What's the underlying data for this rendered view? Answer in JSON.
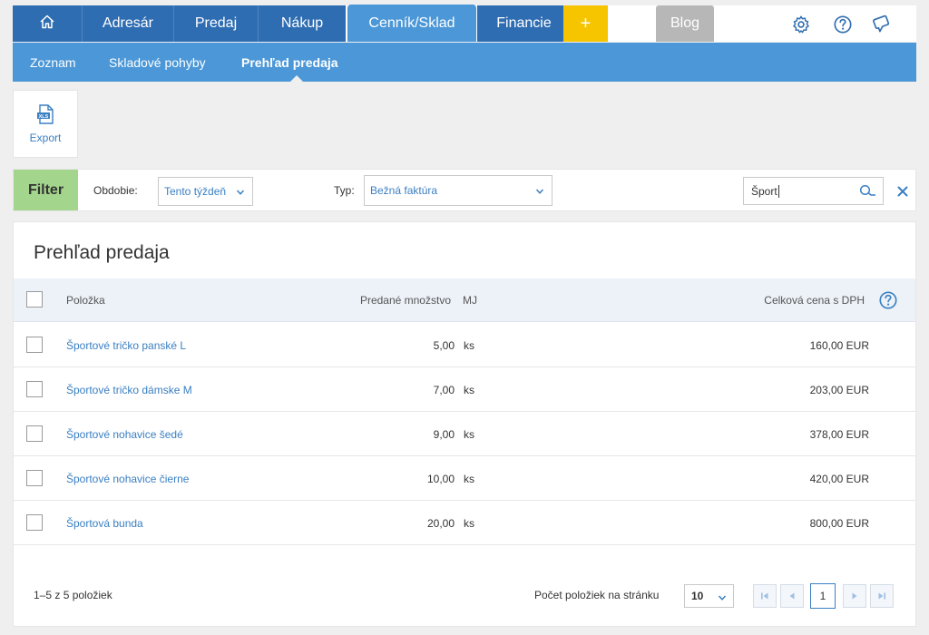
{
  "nav": {
    "home_icon": "home-icon",
    "tabs": [
      "Adresár",
      "Predaj",
      "Nákup",
      "Cenník/Sklad",
      "Financie"
    ],
    "plus": "+",
    "blog": "Blog",
    "icons": [
      "gear-icon",
      "help-icon",
      "chat-icon"
    ]
  },
  "subnav": {
    "items": [
      "Zoznam",
      "Skladové pohyby",
      "Prehľad predaja"
    ],
    "active_index": 2
  },
  "toolbar": {
    "export_label": "Export"
  },
  "filter": {
    "label": "Filter",
    "period_label": "Obdobie:",
    "period_value": "Tento týždeň",
    "type_label": "Typ:",
    "type_value": "Bežná faktúra",
    "search_value": "Šport"
  },
  "table": {
    "title": "Prehľad predaja",
    "columns": {
      "item": "Položka",
      "qty": "Predané množstvo",
      "unit": "MJ",
      "total": "Celková cena s DPH"
    },
    "rows": [
      {
        "item": "Športové tričko panské L",
        "qty": "5,00",
        "unit": "ks",
        "total": "160,00 EUR"
      },
      {
        "item": "Športové tričko dámske M",
        "qty": "7,00",
        "unit": "ks",
        "total": "203,00 EUR"
      },
      {
        "item": "Športové nohavice šedé",
        "qty": "9,00",
        "unit": "ks",
        "total": "378,00 EUR"
      },
      {
        "item": "Športové nohavice čierne",
        "qty": "10,00",
        "unit": "ks",
        "total": "420,00 EUR"
      },
      {
        "item": "Športová bunda",
        "qty": "20,00",
        "unit": "ks",
        "total": "800,00 EUR"
      }
    ]
  },
  "footer": {
    "count_text": "1–5 z 5 položiek",
    "per_page_label": "Počet položiek na stránku",
    "per_page_value": "10",
    "current_page": "1"
  },
  "colors": {
    "nav_dark": "#2f6db2",
    "nav_active": "#4b97d7",
    "plus_yellow": "#f7c500",
    "filter_green": "#a4d58d",
    "link_blue": "#3a7fc2"
  }
}
